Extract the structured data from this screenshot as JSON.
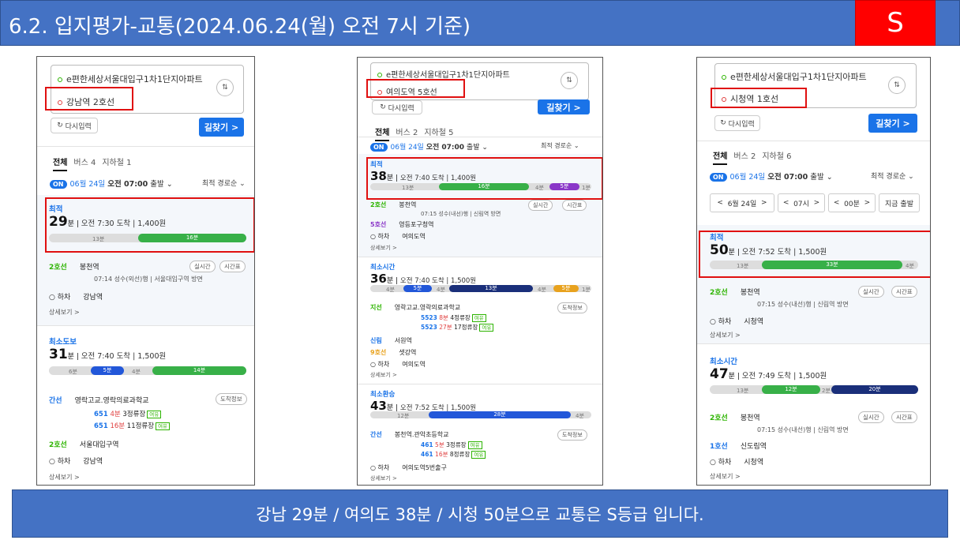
{
  "header": {
    "title": "6.2. 입지평가-교통(2024.06.24(월) 오전 7시 기준)",
    "grade": "S"
  },
  "footer": {
    "summary": "강남 29분 / 여의도 38분 / 시청 50분으로 교통은 S등급 입니다."
  },
  "common": {
    "origin": "e편한세상서울대입구1차1단지아파트",
    "swap": "⇅",
    "reset": "다시입력",
    "find": "길찾기 >",
    "tab_all": "전체",
    "on": "ON",
    "date": "06월 24일",
    "time": "오전 07:00",
    "depart": "출발",
    "sort": "최적 경로순",
    "detail": "상세보기 >",
    "realtime": "실시간",
    "timetable": "시간표",
    "stopinfo": "도착정보",
    "getoff": "○ 하차"
  },
  "panel1": {
    "dest": "강남역 2호선",
    "tab_bus": "버스 4",
    "tab_sub": "지하철 1",
    "r1": {
      "tag": "최적",
      "mins": "29",
      "info": "오전 7:30 도착  |  1,400원",
      "walk": "13분",
      "ride": "16분",
      "l1": "2호선",
      "s1": "봉천역",
      "sub1": "07:14 성수(외선)행 | 서울대입구역 방면",
      "end": "강남역"
    },
    "r2": {
      "tag": "최소도보",
      "mins": "31",
      "info": "오전 7:40 도착  |  1,500원",
      "walk": "6분",
      "b": "5분",
      "w2": "4분",
      "ride": "14분",
      "l1": "간선",
      "s1": "영락고교.영락의료과학교",
      "bus1": "651",
      "bus1t": "4분",
      "bus1s": "3정류장",
      "bus2": "651",
      "bus2t": "16분",
      "bus2s": "11정류장",
      "tag1": "여유",
      "l2": "2호선",
      "s2": "서울대입구역",
      "end": "강남역"
    }
  },
  "panel2": {
    "dest": "여의도역 5호선",
    "tab_bus": "버스 2",
    "tab_sub": "지하철 5",
    "r1": {
      "tag": "최적",
      "mins": "38",
      "info": "오전 7:40 도착  |  1,400원",
      "walk": "13분",
      "ride": "16분",
      "w2": "4분",
      "ride2": "5분",
      "w3": "1분",
      "l1": "2호선",
      "s1": "봉천역",
      "sub1": "07:15 성수(내선)행 | 신림역 방면",
      "l2": "5호선",
      "s2": "영등포구청역",
      "end": "여의도역"
    },
    "r2": {
      "tag": "최소시간",
      "mins": "36",
      "info": "오전 7:40 도착  |  1,500원",
      "walk": "4분",
      "b": "5분",
      "w2": "4분",
      "ride": "13분",
      "w3": "4분",
      "ride2": "5분",
      "w4": "1분",
      "l1": "지선",
      "s1": "영락고교.영락의료과학교",
      "bus1": "5523",
      "bus1t": "8분",
      "bus1s": "4정류장",
      "bus2": "5523",
      "bus2t": "27분",
      "bus2s": "17정류장",
      "tag1": "여유",
      "l2": "신림",
      "s2": "서원역",
      "l3": "9호선",
      "s3": "샛강역",
      "end": "여의도역"
    },
    "r3": {
      "tag": "최소환승",
      "mins": "43",
      "info": "오전 7:52 도착  |  1,500원",
      "walk": "12분",
      "ride": "28분",
      "w2": "4분",
      "l1": "간선",
      "s1": "봉천역.관악초등학교",
      "bus1": "461",
      "bus1t": "5분",
      "bus1s": "3정류장",
      "bus2": "461",
      "bus2t": "16분",
      "bus2s": "8정류장",
      "tag1": "여유",
      "end": "여의도역5번출구"
    }
  },
  "panel3": {
    "dest": "시청역 1호선",
    "tab_bus": "버스 2",
    "tab_sub": "지하철 6",
    "date_cells": [
      "<",
      "6월 24일",
      ">",
      "<",
      "07시",
      ">",
      "<",
      "00분",
      ">",
      "지금 출발"
    ],
    "r1": {
      "tag": "최적",
      "mins": "50",
      "info": "오전 7:52 도착  |  1,500원",
      "walk": "13분",
      "ride": "33분",
      "w2": "4분",
      "l1": "2호선",
      "s1": "봉천역",
      "sub1": "07:15 성수(내선)행 | 신림역 방면",
      "end": "시청역"
    },
    "r2": {
      "tag": "최소시간",
      "mins": "47",
      "info": "오전 7:49 도착  |  1,500원",
      "walk": "13분",
      "ride": "12분",
      "w2": "2분",
      "ride2": "20분",
      "l1": "2호선",
      "s1": "봉천역",
      "sub1": "07:15 성수(내선)행 | 신림역 방면",
      "l2": "1호선",
      "s2": "신도림역",
      "end": "시청역"
    }
  }
}
